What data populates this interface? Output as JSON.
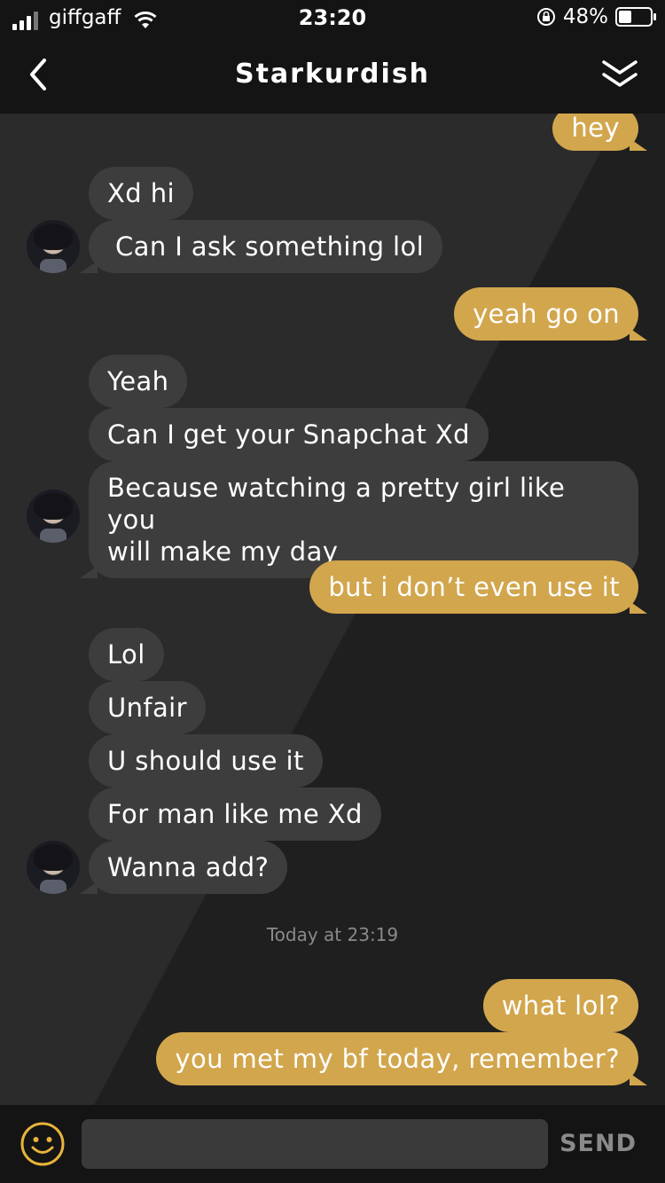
{
  "status_bar": {
    "carrier": "giffgaff",
    "time": "23:20",
    "battery": "48%",
    "battery_level": 0.48,
    "icons": [
      "signal-icon",
      "wifi-icon",
      "orientation-lock-icon",
      "battery-icon"
    ]
  },
  "header": {
    "title": "Starkurdish",
    "back_icon": "chevron-left-icon",
    "collapse_icon": "double-chevron-down-icon"
  },
  "messages": [
    {
      "from": "me",
      "text": "hey"
    },
    {
      "from": "them",
      "text": "Xd hi"
    },
    {
      "from": "them",
      "text": "Can I ask something lol"
    },
    {
      "from": "me",
      "text": "yeah go on"
    },
    {
      "from": "them",
      "text": "Yeah"
    },
    {
      "from": "them",
      "text": "Can I get your Snapchat Xd"
    },
    {
      "from": "them",
      "text_line1": "Because watching a pretty girl like you",
      "text_line2": "will make my day"
    },
    {
      "from": "me",
      "text": "but i don’t even use it"
    },
    {
      "from": "them",
      "text": "Lol"
    },
    {
      "from": "them",
      "text": "Unfair"
    },
    {
      "from": "them",
      "text": "U should use it"
    },
    {
      "from": "them",
      "text": "For man like me Xd"
    },
    {
      "from": "them",
      "text": "Wanna add?"
    },
    {
      "from": "me",
      "text": "what lol?"
    },
    {
      "from": "me",
      "text": "you met my bf today, remember?"
    }
  ],
  "timestamp": "Today at 23:19",
  "composer": {
    "placeholder": "",
    "send_label": "SEND",
    "emoji_icon": "smiley-icon"
  },
  "colors": {
    "background": "#242424",
    "bar": "#141414",
    "incoming_bubble": "#3d3d3d",
    "outgoing_bubble": "#d2a64d",
    "accent": "#e8b33c"
  }
}
